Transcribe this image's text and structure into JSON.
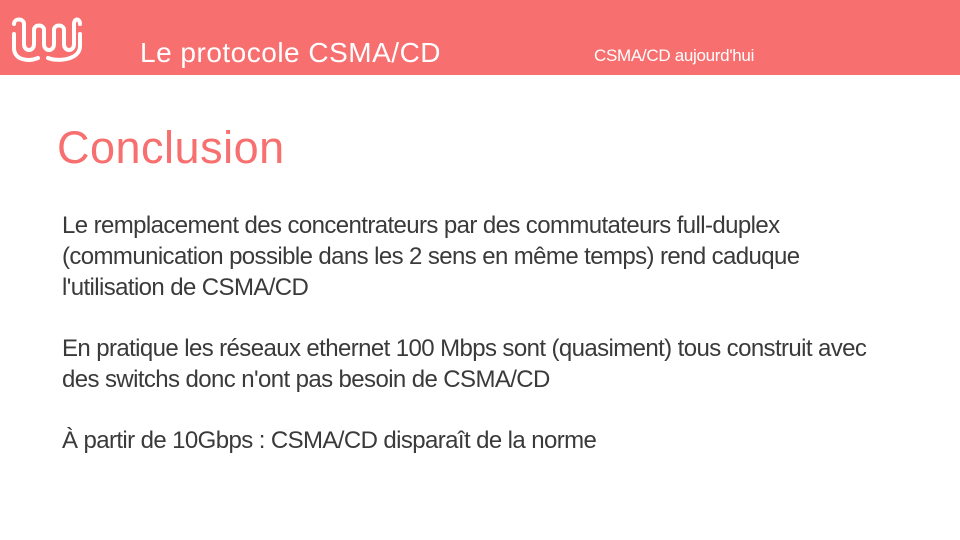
{
  "header": {
    "title": "Le protocole CSMA/CD",
    "section": "CSMA/CD aujourd'hui",
    "logo": "wave-logo-icon",
    "color": "#f76f6f"
  },
  "slide": {
    "title": "Conclusion",
    "title_color": "#f76f6f",
    "paragraphs": [
      "Le remplacement des concentrateurs par des commutateurs full-duplex (communication possible dans les 2 sens en même temps) rend caduque l'utilisation de CSMA/CD",
      "En pratique les réseaux ethernet 100 Mbps sont (quasiment) tous construit avec des switchs donc n'ont pas besoin de CSMA/CD",
      "À partir de 10Gbps : CSMA/CD disparaît de la norme"
    ]
  }
}
